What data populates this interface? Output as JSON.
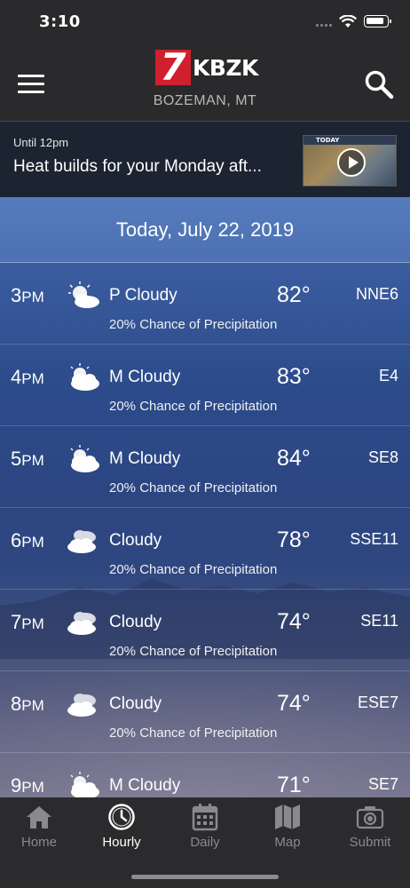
{
  "status_bar": {
    "time": "3:10"
  },
  "header": {
    "logo_number": "7",
    "logo_text": "KBZK",
    "location": "BOZEMAN, MT",
    "icons": {
      "menu": "hamburger-menu-icon",
      "search": "search-icon"
    }
  },
  "banner": {
    "until": "Until 12pm",
    "headline": "Heat builds for your Monday aft...",
    "thumb_label": "TODAY"
  },
  "date": "Today, July 22, 2019",
  "hours": [
    {
      "hour": "3",
      "ampm": "PM",
      "icon": "partly-cloudy-icon",
      "condition": "P Cloudy",
      "temp": "82°",
      "wind": "NNE6",
      "precip": "20% Chance of Precipitation"
    },
    {
      "hour": "4",
      "ampm": "PM",
      "icon": "mostly-cloudy-icon",
      "condition": "M Cloudy",
      "temp": "83°",
      "wind": "E4",
      "precip": "20% Chance of Precipitation"
    },
    {
      "hour": "5",
      "ampm": "PM",
      "icon": "mostly-cloudy-icon",
      "condition": "M Cloudy",
      "temp": "84°",
      "wind": "SE8",
      "precip": "20% Chance of Precipitation"
    },
    {
      "hour": "6",
      "ampm": "PM",
      "icon": "cloudy-icon",
      "condition": "Cloudy",
      "temp": "78°",
      "wind": "SSE11",
      "precip": "20% Chance of Precipitation"
    },
    {
      "hour": "7",
      "ampm": "PM",
      "icon": "cloudy-icon",
      "condition": "Cloudy",
      "temp": "74°",
      "wind": "SE11",
      "precip": "20% Chance of Precipitation"
    },
    {
      "hour": "8",
      "ampm": "PM",
      "icon": "cloudy-icon",
      "condition": "Cloudy",
      "temp": "74°",
      "wind": "ESE7",
      "precip": "20% Chance of Precipitation"
    },
    {
      "hour": "9",
      "ampm": "PM",
      "icon": "mostly-cloudy-icon",
      "condition": "M Cloudy",
      "temp": "71°",
      "wind": "SE7",
      "precip": ""
    }
  ],
  "tabs": [
    {
      "label": "Home",
      "icon": "home-icon",
      "active": false
    },
    {
      "label": "Hourly",
      "icon": "clock-icon",
      "active": true
    },
    {
      "label": "Daily",
      "icon": "calendar-icon",
      "active": false
    },
    {
      "label": "Map",
      "icon": "map-icon",
      "active": false
    },
    {
      "label": "Submit",
      "icon": "camera-icon",
      "active": false
    }
  ],
  "colors": {
    "header_bg": "#2a2a2c",
    "logo_red": "#d0202e",
    "tab_active": "#ffffff",
    "tab_inactive": "#8a8a8c"
  }
}
